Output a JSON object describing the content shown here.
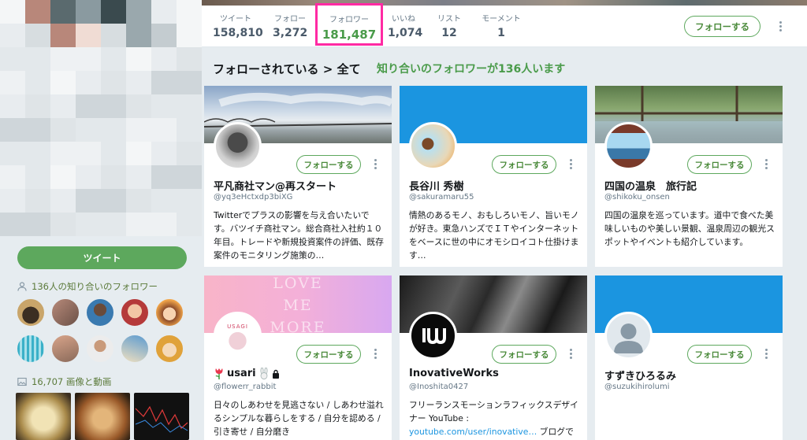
{
  "topnav": {
    "stats": [
      {
        "label": "ツイート",
        "value": "158,810"
      },
      {
        "label": "フォロー",
        "value": "3,272"
      },
      {
        "label": "フォロワー",
        "value": "181,487"
      },
      {
        "label": "いいね",
        "value": "1,074"
      },
      {
        "label": "リスト",
        "value": "12"
      },
      {
        "label": "モーメント",
        "value": "1"
      }
    ],
    "follow_label": "フォローする",
    "highlight_color": "#ff2aa3"
  },
  "sidebar": {
    "tweet_label": "ツイート",
    "known_followers_label": "136人の知り合いのフォロワー",
    "media_label": "16,707 画像と動画"
  },
  "section": {
    "title": "フォローされている > 全て",
    "subtitle": "知り合いのフォロワーが136人います"
  },
  "cards": [
    {
      "name": "平凡商社マン@再スタート",
      "handle": "@yq3eHctxdp3biXG",
      "follow_label": "フォローする",
      "bio": "Twitterでプラスの影響を与え合いたいです。バツイチ商社マン。総合商社入社約１０年目。トレードや新規投資案件の評価、既存案件のモニタリング施策の…"
    },
    {
      "name": "長谷川 秀樹",
      "handle": "@sakuramaru55",
      "follow_label": "フォローする",
      "bio": "情熱のあるモノ、おもしろいモノ、旨いモノが好き。東急ハンズでＩＴやインターネットをベースに世の中にオモシロイコト仕掛けます…"
    },
    {
      "name": "四国の温泉　旅行記",
      "handle": "@shikoku_onsen",
      "follow_label": "フォローする",
      "bio": "四国の温泉を巡っています。道中で食べた美味しいものや美しい景観、温泉周辺の観光スポットやイベントも紹介しています。"
    },
    {
      "name": "usari",
      "handle": "@flowerr_rabbit",
      "follow_label": "フォローする",
      "banner_text": [
        "LOVE",
        "ME",
        "MORE"
      ],
      "avatar_text": "USAGI",
      "bio": "日々のしあわせを見逃さない / しあわせ溢れるシンプルな暮らしをする / 自分を認める / 引き寄せ / 自分磨き"
    },
    {
      "name": "InovativeWorks",
      "handle": "@Inoshita0427",
      "follow_label": "フォローする",
      "bio": "フリーランスモーションラフィックスデザイナー YouTube :",
      "bio_link": "youtube.com/user/inovative…",
      "bio_tail": " ブログで"
    },
    {
      "name": "すずきひろるみ",
      "handle": "@suzukihirolumi",
      "follow_label": "フォローする",
      "bio": ""
    }
  ],
  "icons": {
    "people": "people-icon",
    "image": "image-icon",
    "more": "more-vertical-icon",
    "lock": "lock-icon",
    "tulip": "tulip-icon",
    "rabbit": "rabbit-icon"
  },
  "colors": {
    "accent_green": "#5da85d",
    "link_blue": "#1b95e0",
    "follower_count_green": "#4a9b4a"
  }
}
